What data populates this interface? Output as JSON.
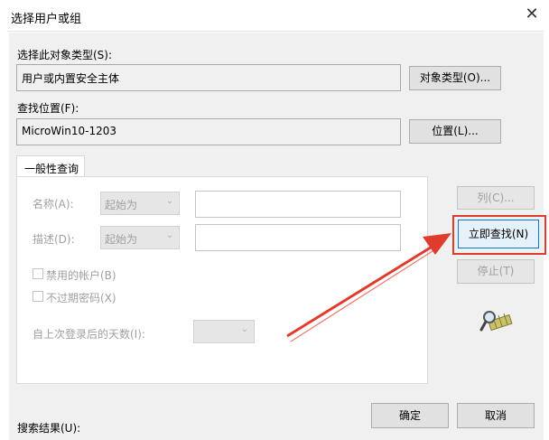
{
  "window": {
    "title": "选择用户或组",
    "close_glyph": "✕"
  },
  "object_type": {
    "label": "选择此对象类型(S):",
    "value": "用户或内置安全主体",
    "button": "对象类型(O)..."
  },
  "location": {
    "label": "查找位置(F):",
    "value": "MicroWin10-1203",
    "button": "位置(L)..."
  },
  "tab": {
    "label": "一般性查询"
  },
  "query": {
    "name_label": "名称(A):",
    "name_mode": "起始为",
    "desc_label": "描述(D):",
    "desc_mode": "起始为",
    "disabled_accounts": "禁用的帐户(B)",
    "non_expiring_pw": "不过期密码(X)",
    "days_since_logon": "自上次登录后的天数(I):"
  },
  "side_buttons": {
    "columns": "列(C)...",
    "find_now": "立即查找(N)",
    "stop": "停止(T)"
  },
  "footer": {
    "ok": "确定",
    "cancel": "取消",
    "results_label": "搜索结果(U):"
  },
  "colors": {
    "highlight": "#e03c2e",
    "dialog_bg": "#f0f0f0"
  },
  "icons": {
    "search_anim": "magnifier-icon",
    "chevron": "chevron-down-icon",
    "close": "close-icon"
  }
}
